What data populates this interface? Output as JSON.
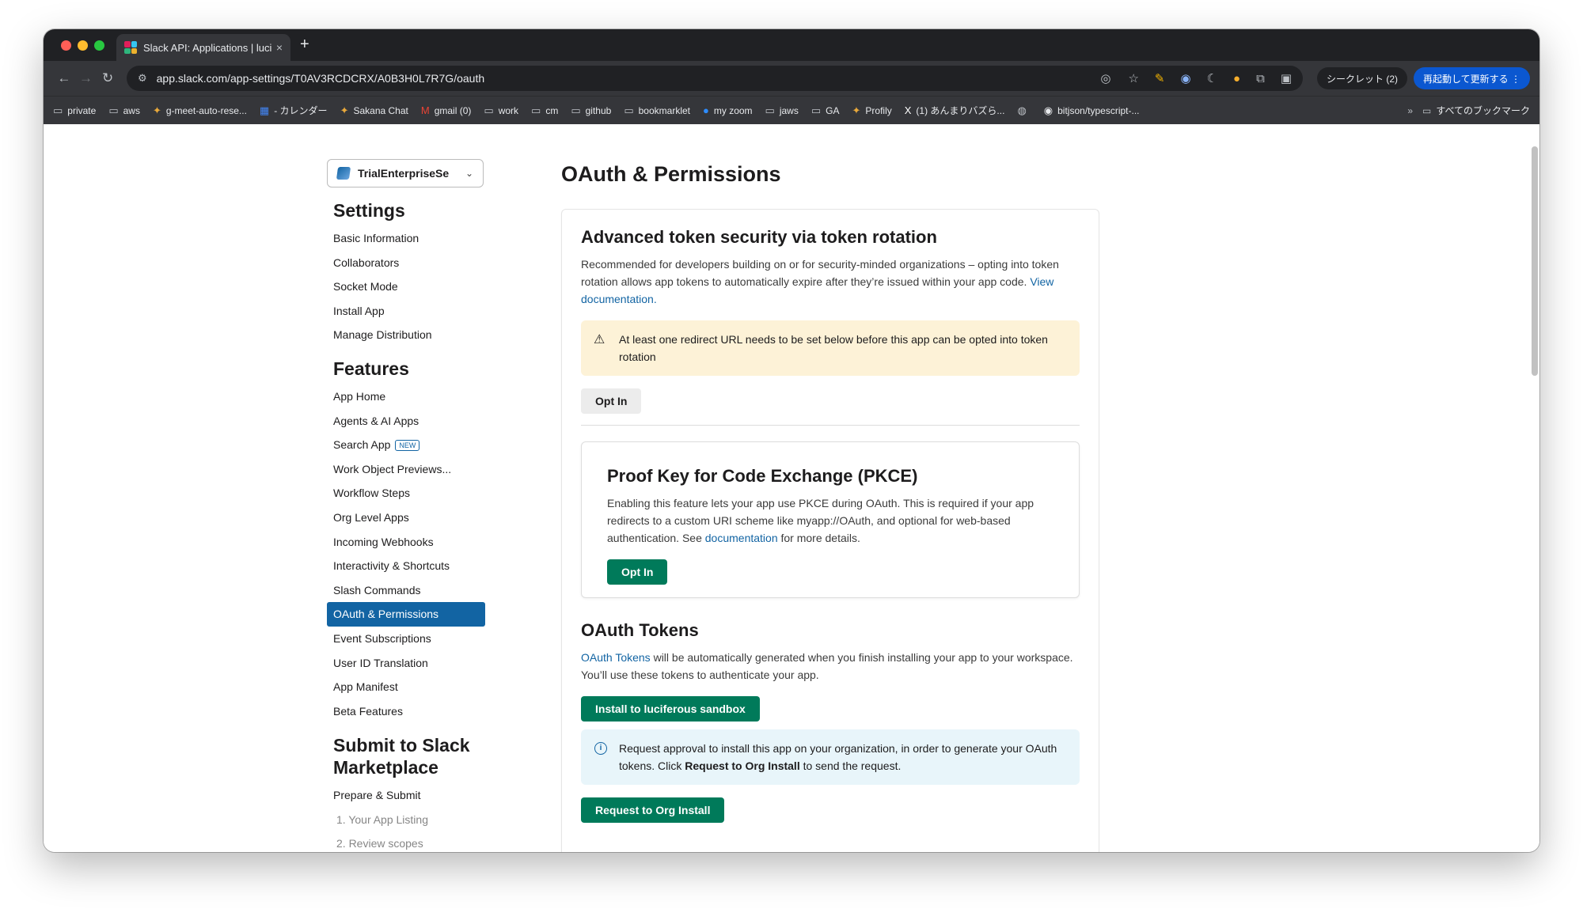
{
  "browser": {
    "tab_title": "Slack API: Applications | lucife",
    "tab_close": "×",
    "new_tab": "+",
    "url": "app.slack.com/app-settings/T0AV3RCDCRX/A0B3H0L7R7G/oauth",
    "incognito_label": "シークレット (2)",
    "relaunch_label": "再起動して更新する ⋮",
    "bookmarks": [
      {
        "icon": "folder-icon",
        "label": "private"
      },
      {
        "icon": "folder-icon",
        "label": "aws"
      },
      {
        "icon": "link-icon",
        "label": "g-meet-auto-rese..."
      },
      {
        "icon": "calendar-icon",
        "label": "- カレンダー"
      },
      {
        "icon": "link-icon",
        "label": "Sakana Chat"
      },
      {
        "icon": "gmail-icon",
        "label": "gmail (0)"
      },
      {
        "icon": "folder-icon",
        "label": "work"
      },
      {
        "icon": "folder-icon",
        "label": "cm"
      },
      {
        "icon": "folder-icon",
        "label": "github"
      },
      {
        "icon": "folder-icon",
        "label": "bookmarklet"
      },
      {
        "icon": "zoom-icon",
        "label": "my zoom"
      },
      {
        "icon": "folder-icon",
        "label": "jaws"
      },
      {
        "icon": "folder-icon",
        "label": "GA"
      },
      {
        "icon": "link-icon",
        "label": "Profily"
      },
      {
        "icon": "x-icon",
        "label": "(1) あんまりバズら..."
      },
      {
        "icon": "globe-icon",
        "label": ""
      },
      {
        "icon": "github-icon",
        "label": "bitjson/typescript-..."
      }
    ],
    "bookmarks_more": "»",
    "all_bookmarks": "すべてのブックマーク"
  },
  "sidebar": {
    "team_name": "TrialEnterpriseSe",
    "settings_heading": "Settings",
    "settings_items": [
      "Basic Information",
      "Collaborators",
      "Socket Mode",
      "Install App",
      "Manage Distribution"
    ],
    "features_heading": "Features",
    "features_items": [
      {
        "label": "App Home"
      },
      {
        "label": "Agents & AI Apps"
      },
      {
        "label": "Search App",
        "badge": "NEW"
      },
      {
        "label": "Work Object Previews..."
      },
      {
        "label": "Workflow Steps"
      },
      {
        "label": "Org Level Apps"
      },
      {
        "label": "Incoming Webhooks"
      },
      {
        "label": "Interactivity & Shortcuts"
      },
      {
        "label": "Slash Commands"
      },
      {
        "label": "OAuth & Permissions",
        "active": true
      },
      {
        "label": "Event Subscriptions"
      },
      {
        "label": "User ID Translation"
      },
      {
        "label": "App Manifest"
      },
      {
        "label": "Beta Features"
      }
    ],
    "submit_heading": "Submit to Slack Marketplace",
    "submit_items": [
      "Prepare & Submit"
    ],
    "submit_subitems": [
      "1. Your App Listing",
      "2. Review scopes"
    ]
  },
  "main": {
    "title": "OAuth & Permissions",
    "token_rotation": {
      "heading": "Advanced token security via token rotation",
      "text": "Recommended for developers building on or for security-minded organizations – opting into token rotation allows app tokens to automatically expire after they’re issued within your app code.",
      "link": "View documentation.",
      "warning": "At least one redirect URL needs to be set below before this app can be opted into token rotation",
      "button": "Opt In"
    },
    "pkce": {
      "heading": "Proof Key for Code Exchange (PKCE)",
      "text_before": "Enabling this feature lets your app use PKCE during OAuth. This is required if your app redirects to a custom URI scheme like myapp://OAuth, and optional for web-based authentication. See",
      "link": "documentation",
      "text_after": "for more details.",
      "button": "Opt In"
    },
    "oauth_tokens": {
      "heading": "OAuth Tokens",
      "link": "OAuth Tokens",
      "text": "will be automatically generated when you finish installing your app to your workspace. You’ll use these tokens to authenticate your app.",
      "install_button": "Install to luciferous sandbox",
      "info_before": "Request approval to install this app on your organization, in order to generate your OAuth tokens. Click",
      "info_bold": "Request to Org Install",
      "info_after": "to send the request.",
      "request_button": "Request to Org Install"
    }
  },
  "colors": {
    "slack_blue": "#1264a3",
    "slack_green": "#007a5a",
    "warning_bg": "#fdf2d7",
    "info_bg": "#e8f5fa"
  }
}
